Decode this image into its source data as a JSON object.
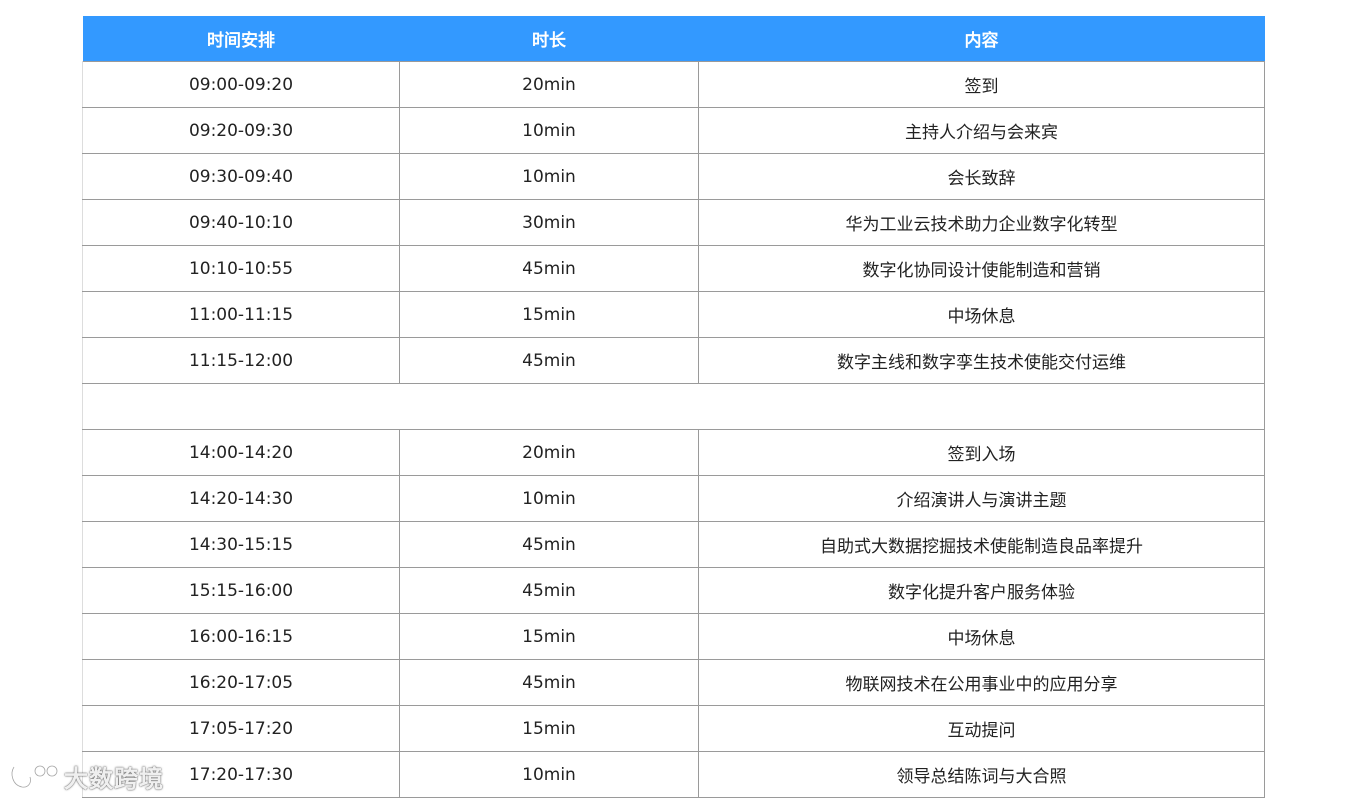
{
  "table": {
    "headers": {
      "time": "时间安排",
      "duration": "时长",
      "content": "内容"
    },
    "morning": [
      {
        "time": "09:00-09:20",
        "duration": "20min",
        "content": "签到"
      },
      {
        "time": "09:20-09:30",
        "duration": "10min",
        "content": "主持人介绍与会来宾"
      },
      {
        "time": "09:30-09:40",
        "duration": "10min",
        "content": "会长致辞"
      },
      {
        "time": "09:40-10:10",
        "duration": "30min",
        "content": "华为工业云技术助力企业数字化转型"
      },
      {
        "time": "10:10-10:55",
        "duration": "45min",
        "content": "数字化协同设计使能制造和营销"
      },
      {
        "time": "11:00-11:15",
        "duration": "15min",
        "content": "中场休息"
      },
      {
        "time": "11:15-12:00",
        "duration": "45min",
        "content": "数字主线和数字孪生技术使能交付运维"
      }
    ],
    "afternoon": [
      {
        "time": "14:00-14:20",
        "duration": "20min",
        "content": "签到入场"
      },
      {
        "time": "14:20-14:30",
        "duration": "10min",
        "content": "介绍演讲人与演讲主题"
      },
      {
        "time": "14:30-15:15",
        "duration": "45min",
        "content": "自助式大数据挖掘技术使能制造良品率提升"
      },
      {
        "time": "15:15-16:00",
        "duration": "45min",
        "content": "数字化提升客户服务体验"
      },
      {
        "time": "16:00-16:15",
        "duration": "15min",
        "content": "中场休息"
      },
      {
        "time": "16:20-17:05",
        "duration": "45min",
        "content": "物联网技术在公用事业中的应用分享"
      },
      {
        "time": "17:05-17:20",
        "duration": "15min",
        "content": "互动提问"
      },
      {
        "time": "17:20-17:30",
        "duration": "10min",
        "content": "领导总结陈词与大合照"
      }
    ]
  },
  "watermark": {
    "text": "大数跨境"
  },
  "colors": {
    "header_bg": "#3399ff",
    "header_text": "#ffffff",
    "border": "#9a9a9a"
  }
}
